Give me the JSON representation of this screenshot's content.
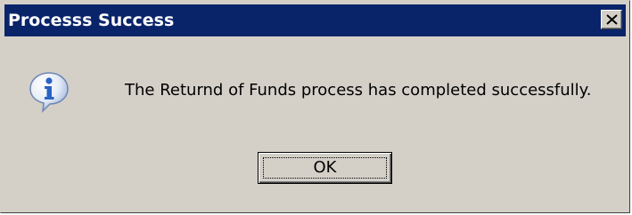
{
  "dialog": {
    "title": "Processs Success",
    "message": "The Returnd of Funds process has completed successfully.",
    "ok_label": "OK",
    "close_glyph": "×",
    "icon": "info-icon"
  },
  "colors": {
    "titlebar": "#0a246a",
    "title_text": "#ffffff",
    "window_face": "#d4d0c8",
    "icon_blue": "#2a63c4"
  }
}
